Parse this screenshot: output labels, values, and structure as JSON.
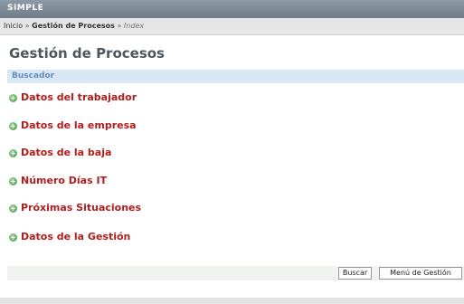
{
  "app": {
    "title": "SIMPLE"
  },
  "breadcrumb": {
    "home": "Inicio",
    "separator": "»",
    "section": "Gestión de Procesos",
    "current": "Index"
  },
  "page": {
    "title": "Gestión de Procesos"
  },
  "search": {
    "label": "Buscador"
  },
  "sections": [
    {
      "label": "Datos del trabajador",
      "icon": "plus-circle-icon"
    },
    {
      "label": "Datos de la empresa",
      "icon": "plus-circle-icon"
    },
    {
      "label": "Datos de la baja",
      "icon": "plus-circle-icon"
    },
    {
      "label": "Número Días IT",
      "icon": "plus-circle-icon"
    },
    {
      "label": "Próximas Situaciones",
      "icon": "plus-circle-icon"
    },
    {
      "label": "Datos de la Gestión",
      "icon": "plus-circle-icon"
    }
  ],
  "buttons": {
    "search": "Buscar",
    "menu": "Menú de Gestión"
  },
  "colors": {
    "header": "#7a8693",
    "section_label": "#b11d1d",
    "search_bar": "#d9e6f3",
    "accent_icon": "#3f9a3a"
  }
}
